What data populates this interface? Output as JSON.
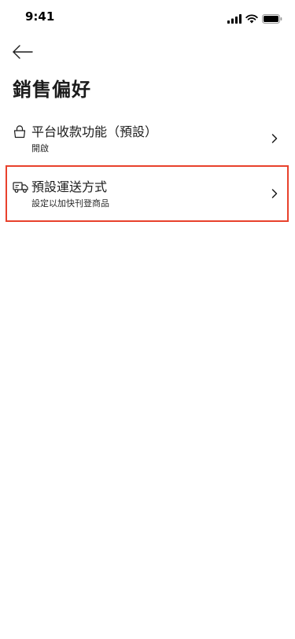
{
  "status_bar": {
    "time": "9:41"
  },
  "header": {
    "back_icon": "arrow-left-icon",
    "title": "銷售偏好"
  },
  "settings": [
    {
      "icon": "lock-icon",
      "title": "平台收款功能（預設）",
      "subtitle": "開啟"
    },
    {
      "icon": "truck-icon",
      "title": "預設運送方式",
      "subtitle": "設定以加快刊登商品"
    }
  ],
  "colors": {
    "highlight": "#e8412c",
    "text": "#1c1c1c"
  }
}
